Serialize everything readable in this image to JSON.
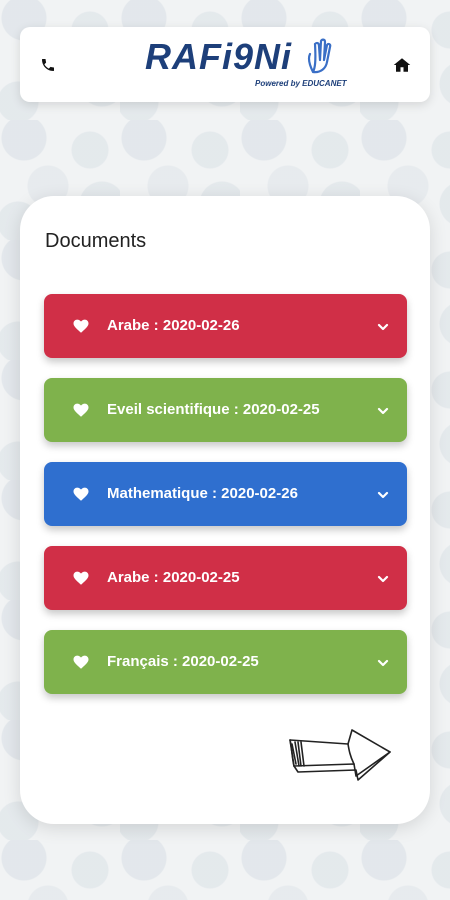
{
  "header": {
    "logo_text": "RAFi9Ni",
    "logo_sub": "Powered by EDUCANET",
    "phone_icon": "phone-icon",
    "home_icon": "home-icon"
  },
  "card": {
    "title": "Documents"
  },
  "documents": [
    {
      "label": "Arabe : 2020-02-26",
      "color": "#d02f47"
    },
    {
      "label": "Eveil scientifique : 2020-02-25",
      "color": "#7fb24c"
    },
    {
      "label": "Mathematique : 2020-02-26",
      "color": "#2f6fcf"
    },
    {
      "label": "Arabe : 2020-02-25",
      "color": "#d02f47"
    },
    {
      "label": "Français : 2020-02-25",
      "color": "#7fb24c"
    }
  ],
  "next_icon": "arrow-right-icon"
}
